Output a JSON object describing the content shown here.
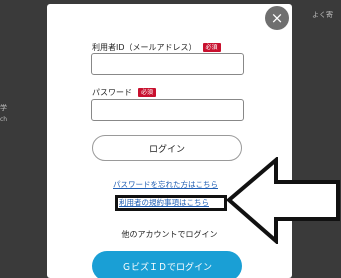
{
  "background": {
    "top_right_text": "よく寄",
    "left_text_1": "学",
    "left_text_2": "ch"
  },
  "modal": {
    "close_icon": "×",
    "user_id_label": "利用者ID（メールアドレス）",
    "required_badge": "必須",
    "password_label": "パスワード",
    "user_id_value": "",
    "password_value": "",
    "login_button": "ログイン",
    "forgot_password_link": "パスワードを忘れた方はこちら",
    "terms_link": "利用者の規約事項はこちら",
    "other_account_text": "他のアカウントでログイン",
    "gbiz_button": "ＧビズＩＤでログイン"
  },
  "colors": {
    "required": "#c8102e",
    "link": "#1e5db3",
    "gbiz": "#1a9fd5",
    "annotation": "#111111"
  },
  "icons": {
    "close": "close-icon",
    "annotation": "left-arrow-icon"
  }
}
